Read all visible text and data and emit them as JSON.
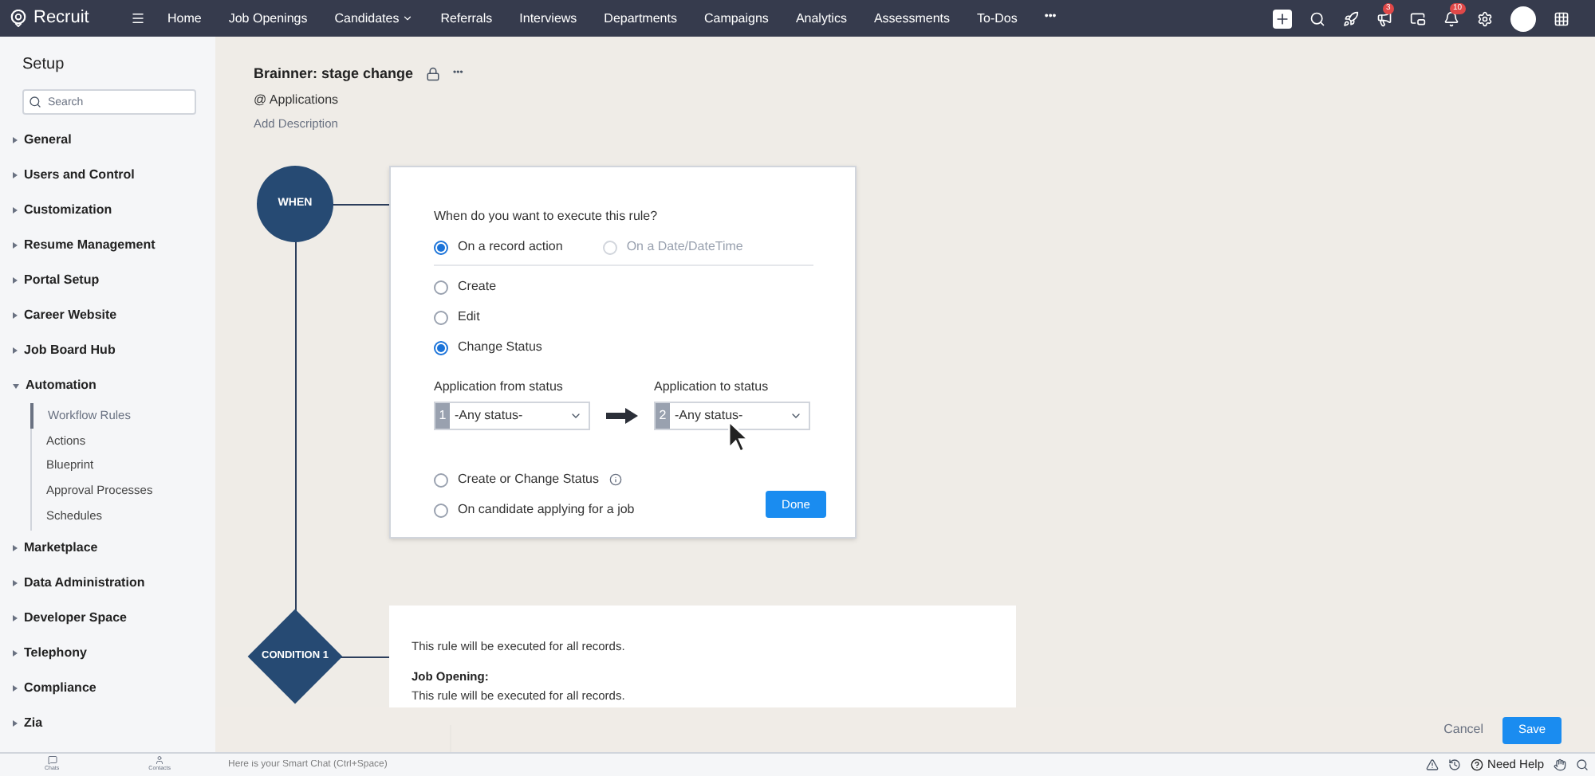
{
  "topbar": {
    "brand": "Recruit",
    "nav": [
      {
        "label": "Home",
        "dropdown": false
      },
      {
        "label": "Job Openings",
        "dropdown": false
      },
      {
        "label": "Candidates",
        "dropdown": true
      },
      {
        "label": "Referrals",
        "dropdown": false
      },
      {
        "label": "Interviews",
        "dropdown": false
      },
      {
        "label": "Departments",
        "dropdown": false
      },
      {
        "label": "Campaigns",
        "dropdown": false
      },
      {
        "label": "Analytics",
        "dropdown": false
      },
      {
        "label": "Assessments",
        "dropdown": false
      },
      {
        "label": "To-Dos",
        "dropdown": false
      }
    ],
    "more": "•••",
    "announcements_badge": "3",
    "notifications_badge": "10"
  },
  "sidebar": {
    "title": "Setup",
    "search": {
      "placeholder": "Search"
    },
    "items": [
      {
        "label": "General",
        "expanded": false
      },
      {
        "label": "Users and Control",
        "expanded": false
      },
      {
        "label": "Customization",
        "expanded": false
      },
      {
        "label": "Resume Management",
        "expanded": false
      },
      {
        "label": "Portal Setup",
        "expanded": false
      },
      {
        "label": "Career Website",
        "expanded": false
      },
      {
        "label": "Job Board Hub",
        "expanded": false
      },
      {
        "label": "Automation",
        "expanded": true,
        "children": [
          {
            "label": "Workflow Rules",
            "selected": true
          },
          {
            "label": "Actions",
            "selected": false
          },
          {
            "label": "Blueprint",
            "selected": false
          },
          {
            "label": "Approval Processes",
            "selected": false
          },
          {
            "label": "Schedules",
            "selected": false
          }
        ]
      },
      {
        "label": "Marketplace",
        "expanded": false
      },
      {
        "label": "Data Administration",
        "expanded": false
      },
      {
        "label": "Developer Space",
        "expanded": false
      },
      {
        "label": "Telephony",
        "expanded": false
      },
      {
        "label": "Compliance",
        "expanded": false
      },
      {
        "label": "Zia",
        "expanded": false
      }
    ]
  },
  "rule": {
    "title": "Brainner: stage change",
    "module": "@ Applications",
    "add_description": "Add Description",
    "more": "•••"
  },
  "when_node": "WHEN",
  "condition_node": "CONDITION 1",
  "when_card": {
    "question": "When do you want to execute this rule?",
    "trigger_types": [
      {
        "label": "On a record action",
        "selected": true,
        "disabled": false
      },
      {
        "label": "On a Date/DateTime",
        "selected": false,
        "disabled": true
      }
    ],
    "actions": [
      {
        "label": "Create",
        "selected": false,
        "has_info": false
      },
      {
        "label": "Edit",
        "selected": false,
        "has_info": false
      },
      {
        "label": "Change Status",
        "selected": true,
        "has_info": false
      }
    ],
    "from_status": {
      "label": "Application from status",
      "step": "1",
      "value": "-Any status-"
    },
    "to_status": {
      "label": "Application to status",
      "step": "2",
      "value": "-Any status-"
    },
    "more_actions": [
      {
        "label": "Create or Change Status",
        "selected": false,
        "has_info": true
      },
      {
        "label": "On candidate applying for a job",
        "selected": false,
        "has_info": false
      }
    ],
    "done": "Done"
  },
  "condition_card": {
    "lines": [
      {
        "text": "This rule will be executed for all records.",
        "kind": "text"
      },
      {
        "text": "Job Opening:",
        "kind": "heading"
      },
      {
        "text": "This rule will be executed for all records.",
        "kind": "text"
      }
    ]
  },
  "footer": {
    "cancel": "Cancel",
    "save": "Save"
  },
  "bottom_bar": {
    "chats": "Chats",
    "contacts": "Contacts",
    "smart_chat": {
      "placeholder": "Here is your Smart Chat (Ctrl+Space)"
    },
    "help": "Need Help"
  }
}
